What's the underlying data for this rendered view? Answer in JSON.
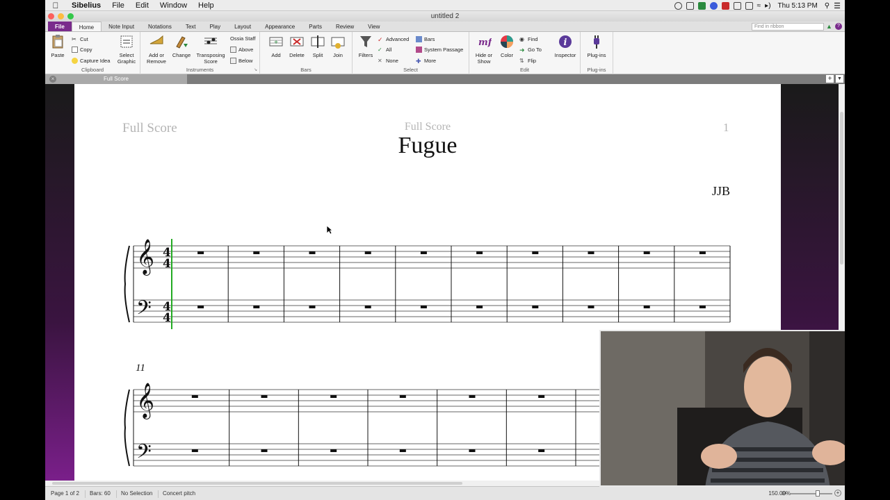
{
  "menubar": {
    "app_name": "Sibelius",
    "items": [
      "File",
      "Edit",
      "Window",
      "Help"
    ],
    "clock": "Thu 5:13 PM"
  },
  "window": {
    "title": "untitled 2"
  },
  "ribbon_tabs": [
    "File",
    "Home",
    "Note Input",
    "Notations",
    "Text",
    "Play",
    "Layout",
    "Appearance",
    "Parts",
    "Review",
    "View"
  ],
  "active_tab": "Home",
  "ribbon_search": {
    "placeholder": "Find in ribbon"
  },
  "ribbon": {
    "clipboard": {
      "label": "Clipboard",
      "paste": "Paste",
      "cut": "Cut",
      "copy": "Copy",
      "capture_idea": "Capture Idea",
      "select_graphic_1": "Select",
      "select_graphic_2": "Graphic"
    },
    "instruments": {
      "label": "Instruments",
      "add_or_remove_1": "Add or",
      "add_or_remove_2": "Remove",
      "change": "Change",
      "transposing_score_1": "Transposing",
      "transposing_score_2": "Score",
      "ossia_staff": "Ossia Staff",
      "above": "Above",
      "below": "Below"
    },
    "bars": {
      "label": "Bars",
      "add": "Add",
      "delete": "Delete",
      "split": "Split",
      "join": "Join"
    },
    "select": {
      "label": "Select",
      "filters": "Filters",
      "advanced": "Advanced",
      "all": "All",
      "none": "None",
      "bars": "Bars",
      "system_passage": "System Passage",
      "more": "More"
    },
    "edit": {
      "label": "Edit",
      "hide_or_show_1": "Hide or",
      "hide_or_show_2": "Show",
      "color": "Color",
      "find": "Find",
      "go_to": "Go To",
      "flip": "Flip",
      "inspector": "Inspector"
    },
    "plugins": {
      "label": "Plug-ins",
      "plugins_button": "Plug-ins"
    }
  },
  "document_tab": "Full Score",
  "score": {
    "header_left": "Full Score",
    "header_center": "Full Score",
    "page_number": "1",
    "title": "Fugue",
    "composer": "JJB",
    "second_system_bar_number": "11",
    "time_signature": "4/4"
  },
  "status": {
    "page": "Page 1 of 2",
    "bars": "Bars: 60",
    "selection": "No Selection",
    "pitch": "Concert pitch",
    "zoom": "150.00%"
  },
  "colors": {
    "file_tab": "#7a2b8c",
    "selection_line": "#22aa22"
  }
}
